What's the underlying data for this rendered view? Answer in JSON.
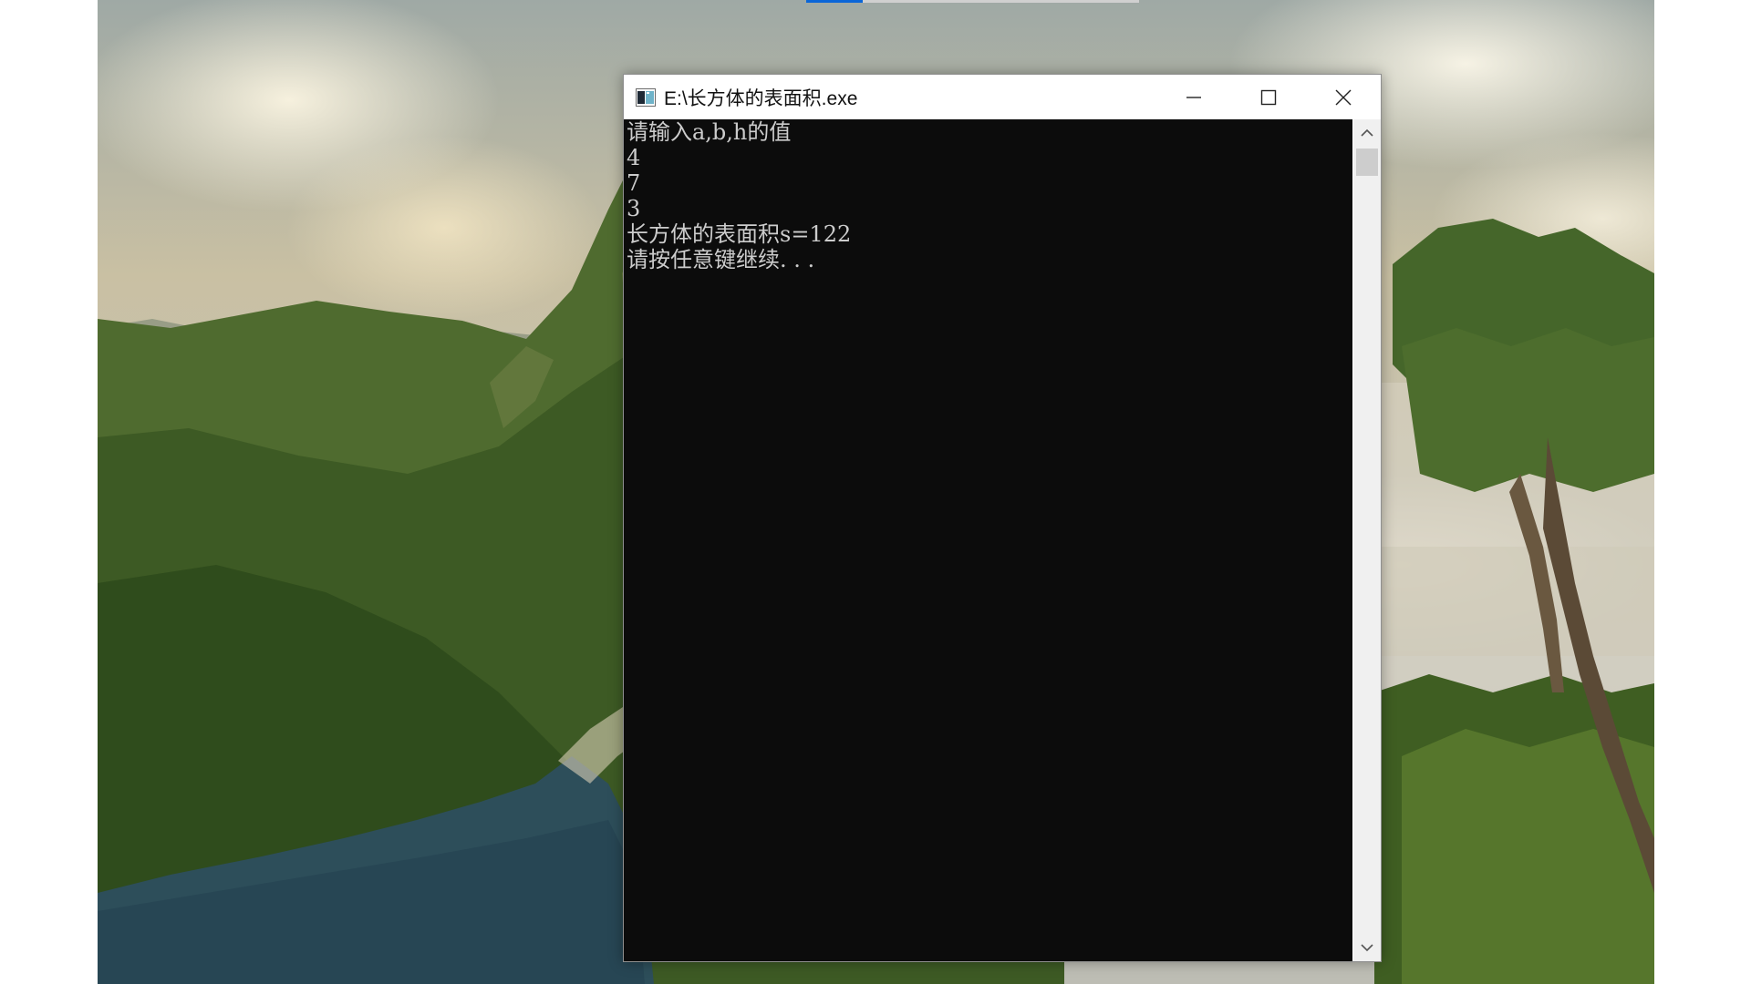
{
  "window": {
    "title": "E:\\长方体的表面积.exe",
    "icon": "console-app-icon",
    "controls": {
      "minimize_icon": "minimize-icon",
      "maximize_icon": "maximize-icon",
      "close_icon": "close-icon"
    }
  },
  "console": {
    "lines": [
      "请输入a,b,h的值",
      "4",
      "7",
      "3",
      "长方体的表面积s=122",
      "请按任意键继续. . ."
    ],
    "background": "#0c0c0c",
    "foreground": "#cccccc"
  },
  "scrollbar": {
    "up_icon": "chevron-up-icon",
    "down_icon": "chevron-down-icon"
  },
  "desktop": {
    "wallpaper": "tropical coastal mountains wallpaper",
    "top_progress": 0.17,
    "progress_color": "#0a66d8"
  }
}
